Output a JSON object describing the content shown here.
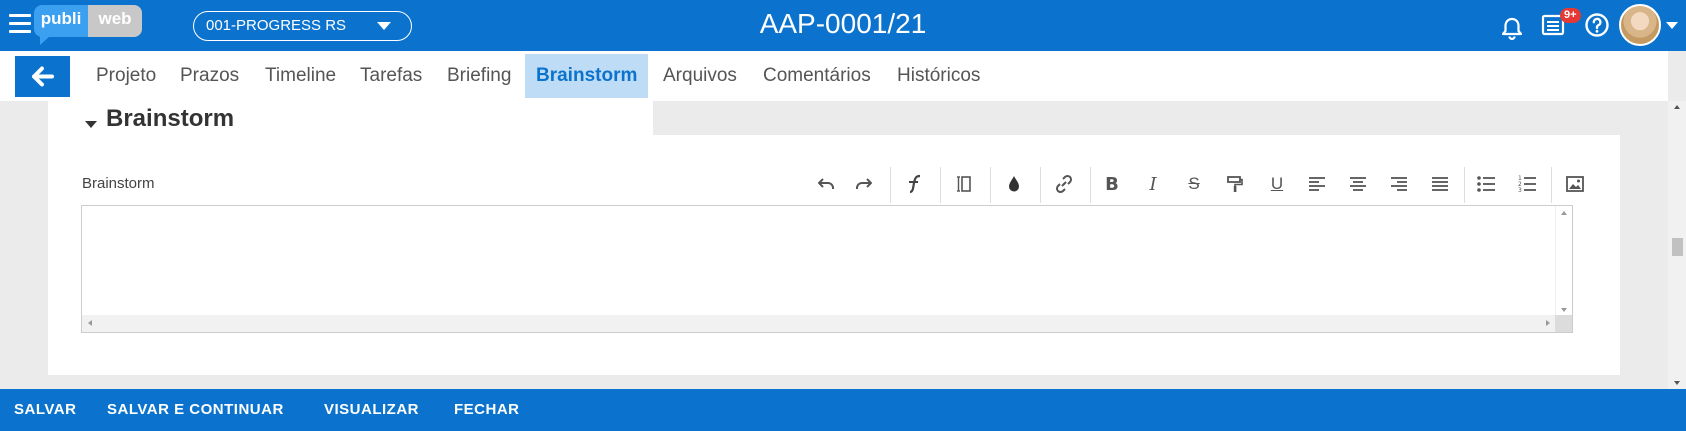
{
  "app": {
    "logo_left": "publi",
    "logo_right": "web",
    "project_select": "001-PROGRESS RS",
    "title": "AAP-0001/21",
    "notification_badge": "9+",
    "colors": {
      "primary": "#0b73cd",
      "active_tab_bg": "#bfdcf6",
      "badge": "#e53935"
    }
  },
  "nav": {
    "tabs": [
      {
        "label": "Projeto"
      },
      {
        "label": "Prazos"
      },
      {
        "label": "Timeline"
      },
      {
        "label": "Tarefas"
      },
      {
        "label": "Briefing"
      },
      {
        "label": "Brainstorm",
        "active": true
      },
      {
        "label": "Arquivos"
      },
      {
        "label": "Comentários"
      },
      {
        "label": "Históricos"
      }
    ]
  },
  "section": {
    "title": "Brainstorm",
    "field_label": "Brainstorm",
    "editor_value": ""
  },
  "toolbar": {
    "icons": [
      "undo-icon",
      "redo-icon",
      "font-icon",
      "paragraph-format-icon",
      "text-color-icon",
      "link-icon",
      "bold-icon",
      "italic-icon",
      "strikethrough-icon",
      "format-painter-icon",
      "underline-icon",
      "align-left-icon",
      "align-center-icon",
      "align-right-icon",
      "align-justify-icon",
      "bullet-list-icon",
      "numbered-list-icon",
      "image-icon"
    ]
  },
  "footer": {
    "save": "SALVAR",
    "save_continue": "SALVAR E CONTINUAR",
    "preview": "VISUALIZAR",
    "close": "FECHAR"
  }
}
